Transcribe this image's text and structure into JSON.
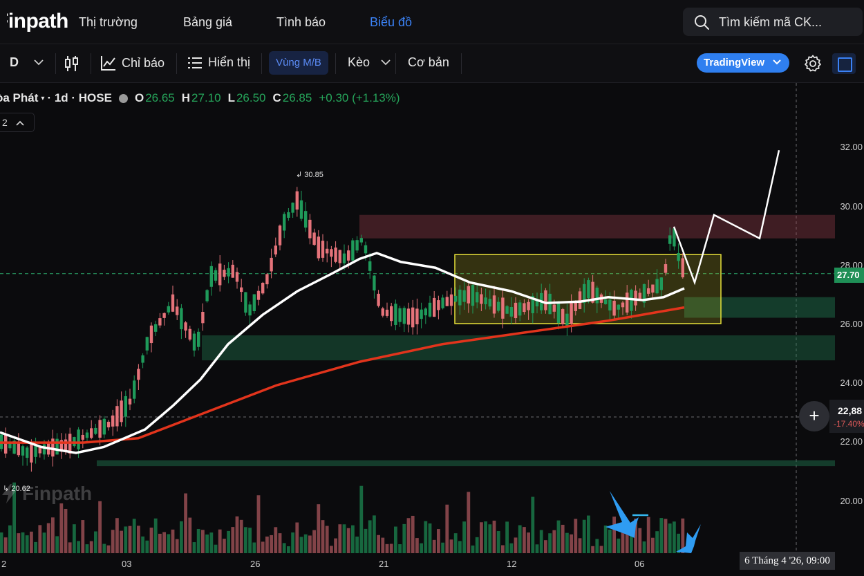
{
  "app": {
    "logo": "Finpath"
  },
  "nav": {
    "items": [
      "Thị trường",
      "Bảng giá",
      "Tình báo",
      "Biểu đồ"
    ],
    "active_index": 3
  },
  "search": {
    "placeholder": "Tìm kiếm mã CK..."
  },
  "toolbar": {
    "interval": "D",
    "indicators_label": "Chỉ báo",
    "display_label": "Hiển thị",
    "zone_label": "Vùng M/B",
    "trade_label": "Kèo",
    "basic_label": "Cơ bản",
    "tradingview_label": "TradingView"
  },
  "legend": {
    "symbol": "òa Phát",
    "interval": "1d",
    "exchange": "HOSE",
    "open_label": "O",
    "open": "26.65",
    "high_label": "H",
    "high": "27.10",
    "low_label": "L",
    "low": "26.50",
    "close_label": "C",
    "close": "26.85",
    "change": "+0.30 (+1.13%)",
    "collapse_label": "2"
  },
  "colors": {
    "up": "#1f9a5a",
    "down": "#e5737a",
    "ma_fast": "#ffffff",
    "ma_slow": "#e2341c",
    "box": "#e8e23a",
    "accent": "#3b82f6"
  },
  "chart_data": {
    "type": "candlestick",
    "interval": "1d",
    "y_ticks": [
      "32.00",
      "30.00",
      "28.00",
      "26.00",
      "24.00",
      "22.00",
      "20.00"
    ],
    "ylim": [
      18.2,
      32.6
    ],
    "x_ticks": [
      "2",
      "03",
      "26",
      "21",
      "12",
      "06"
    ],
    "high_annotation": "30.85",
    "low_annotation": "20.62",
    "last_price": "27.70",
    "crosshair_price": "22,88",
    "crosshair_change": "-17.40%",
    "crosshair_date": "6 Tháng 4 '26, 09:00",
    "resistance_zone": [
      28.9,
      29.7
    ],
    "consolidation_box": [
      26.0,
      28.35
    ],
    "support_zones": [
      [
        26.2,
        26.9
      ],
      [
        24.75,
        25.6
      ],
      [
        21.15,
        21.35
      ]
    ],
    "projection": [
      27.4,
      29.7,
      28.9,
      31.9
    ],
    "watermark": "Finpath"
  }
}
